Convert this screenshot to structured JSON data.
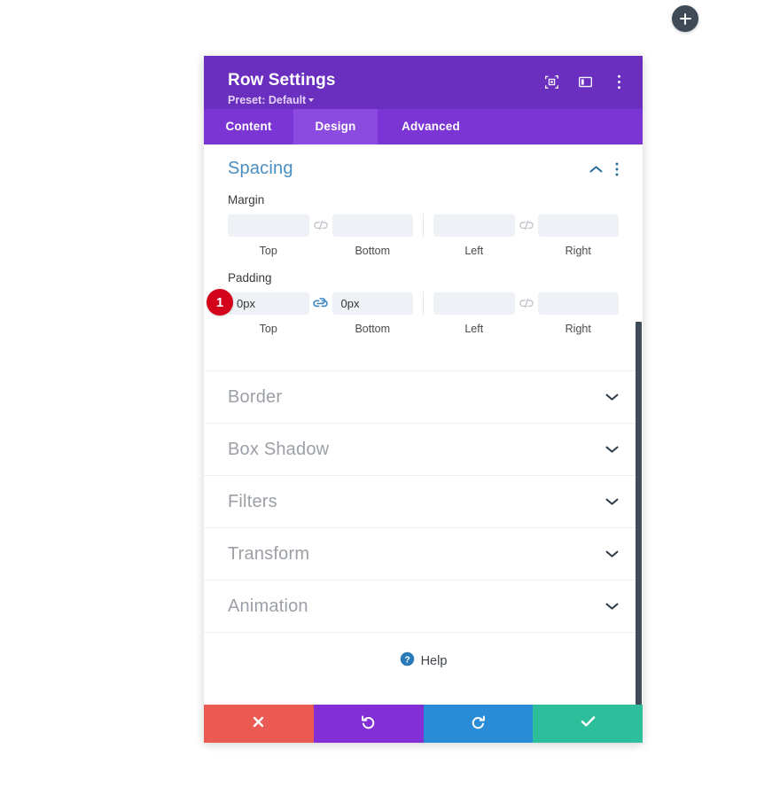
{
  "add_button": {
    "icon": "plus-icon",
    "label": "+"
  },
  "modal": {
    "title": "Row Settings",
    "preset_label": "Preset: Default",
    "header_icons": [
      {
        "name": "focus-target-icon"
      },
      {
        "name": "panel-layout-icon"
      },
      {
        "name": "more-vertical-icon"
      }
    ],
    "tabs": [
      {
        "label": "Content",
        "active": false
      },
      {
        "label": "Design",
        "active": true
      },
      {
        "label": "Advanced",
        "active": false
      }
    ],
    "spacing": {
      "title": "Spacing",
      "collapse_icon": "chevron-up-icon",
      "menu_icon": "more-vertical-icon",
      "margin": {
        "label": "Margin",
        "fields": [
          {
            "caption": "Top",
            "value": "",
            "placeholder": ""
          },
          {
            "caption": "Bottom",
            "value": "",
            "placeholder": ""
          },
          {
            "caption": "Left",
            "value": "",
            "placeholder": ""
          },
          {
            "caption": "Right",
            "value": "",
            "placeholder": ""
          }
        ],
        "link_state_vertical": "unlinked",
        "link_state_horizontal": "unlinked"
      },
      "padding": {
        "label": "Padding",
        "step_badge": "1",
        "fields": [
          {
            "caption": "Top",
            "value": "0px",
            "placeholder": ""
          },
          {
            "caption": "Bottom",
            "value": "0px",
            "placeholder": ""
          },
          {
            "caption": "Left",
            "value": "",
            "placeholder": ""
          },
          {
            "caption": "Right",
            "value": "",
            "placeholder": ""
          }
        ],
        "link_state_vertical": "linked",
        "link_state_horizontal": "unlinked"
      }
    },
    "sections": [
      {
        "label": "Border",
        "icon": "chevron-down-icon"
      },
      {
        "label": "Box Shadow",
        "icon": "chevron-down-icon"
      },
      {
        "label": "Filters",
        "icon": "chevron-down-icon"
      },
      {
        "label": "Transform",
        "icon": "chevron-down-icon"
      },
      {
        "label": "Animation",
        "icon": "chevron-down-icon"
      }
    ],
    "help": {
      "label": "Help",
      "icon": "question-circle-icon"
    },
    "footer": [
      {
        "name": "cancel",
        "icon": "close-x-icon",
        "color": "#eb5a52"
      },
      {
        "name": "undo",
        "icon": "undo-arrow-icon",
        "color": "#8230d6"
      },
      {
        "name": "redo",
        "icon": "redo-arrow-icon",
        "color": "#2a8bd6"
      },
      {
        "name": "save",
        "icon": "check-icon",
        "color": "#2dbe9c"
      }
    ]
  },
  "colors": {
    "header_purple": "#6b2fbf",
    "tabbar_purple": "#7b35d4",
    "tab_active_purple": "#8b4ae0",
    "section_title_blue": "#4a8ec2",
    "badge_red": "#d3021a",
    "link_active_blue": "#3d87c4"
  }
}
